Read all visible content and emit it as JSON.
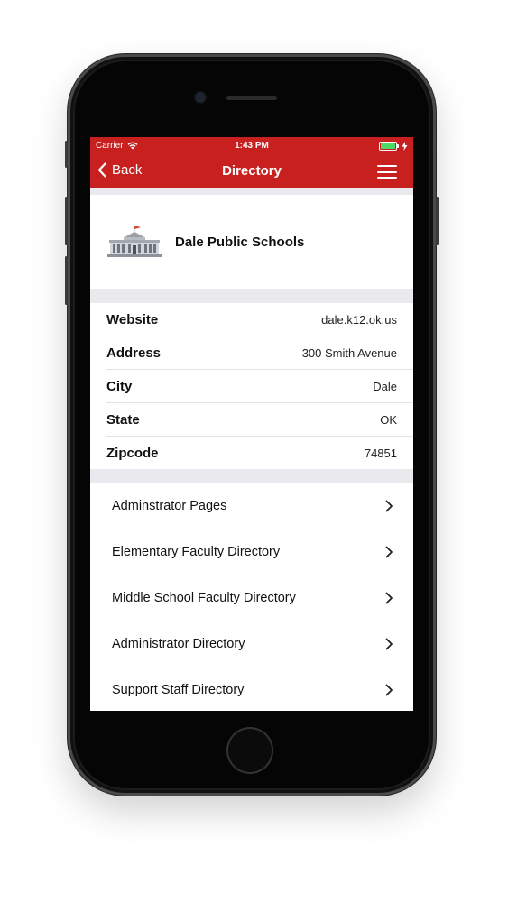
{
  "status_bar": {
    "carrier": "Carrier",
    "time": "1:43 PM",
    "battery_color": "#4cd964"
  },
  "nav": {
    "back_label": "Back",
    "title": "Directory",
    "bar_color": "#c8201f",
    "menu_icon": "hamburger-menu-icon"
  },
  "school": {
    "name": "Dale Public Schools",
    "icon": "school-building-icon"
  },
  "info": [
    {
      "label": "Website",
      "value": "dale.k12.ok.us"
    },
    {
      "label": "Address",
      "value": "300 Smith Avenue"
    },
    {
      "label": "City",
      "value": "Dale"
    },
    {
      "label": "State",
      "value": "OK"
    },
    {
      "label": "Zipcode",
      "value": "74851"
    }
  ],
  "links": [
    {
      "label": "Adminstrator Pages"
    },
    {
      "label": "Elementary Faculty Directory"
    },
    {
      "label": "Middle School Faculty Directory"
    },
    {
      "label": "Administrator Directory"
    },
    {
      "label": "Support Staff Directory"
    }
  ]
}
